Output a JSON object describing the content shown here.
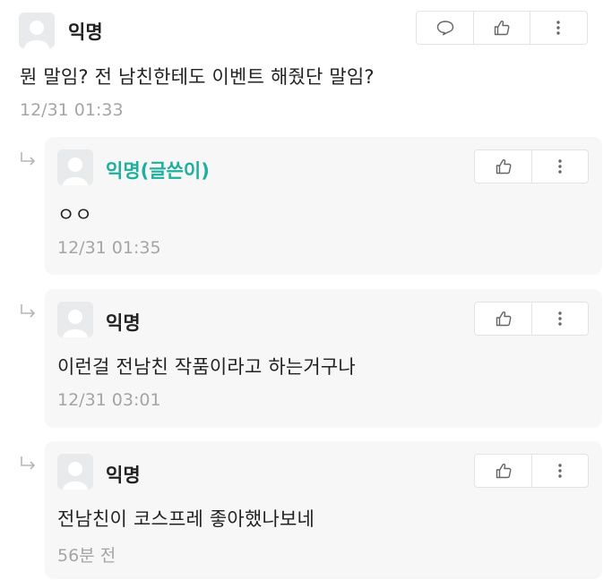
{
  "main_comment": {
    "nickname": "익명",
    "text": "뭔 말임? 전 남친한테도 이벤트 해줬단 말임?",
    "time": "12/31 01:33"
  },
  "replies": [
    {
      "nickname": "익명(글쓴이)",
      "text": "ㅇㅇ",
      "time": "12/31 01:35",
      "is_author": true
    },
    {
      "nickname": "익명",
      "text": "이런걸 전남친 작품이라고 하는거구나",
      "time": "12/31 03:01",
      "is_author": false
    },
    {
      "nickname": "익명",
      "text": "전남친이 코스프레 좋아했나보네",
      "time": "56분 전",
      "is_author": false
    }
  ],
  "icons": {
    "reply": "speech-bubble-icon",
    "like": "thumbs-up-icon",
    "more": "vertical-dots-icon",
    "reply_indicator": "reply-arrow-icon",
    "avatar": "default-user-avatar"
  },
  "colors": {
    "author_nickname": "#1faf9e",
    "timestamp": "#a5a5a5",
    "reply_background": "#f7f7f7",
    "button_border": "#e3e3e3"
  }
}
